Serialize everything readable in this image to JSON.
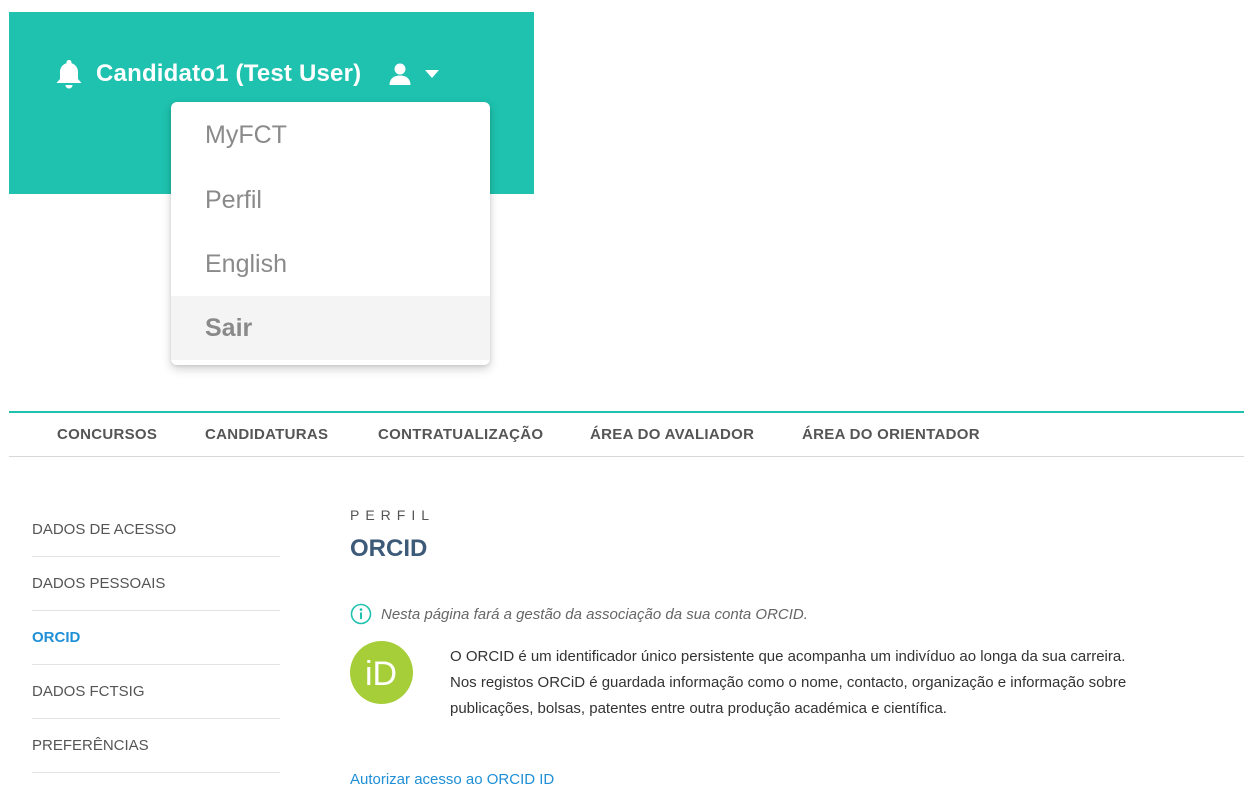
{
  "header": {
    "user_name": "Candidato1 (Test User)",
    "brand_color": "#1ec2ae"
  },
  "dropdown": {
    "items": [
      {
        "label": "MyFCT"
      },
      {
        "label": "Perfil"
      },
      {
        "label": "English"
      },
      {
        "label": "Sair"
      }
    ]
  },
  "nav": {
    "items": [
      {
        "label": "CONCURSOS"
      },
      {
        "label": "CANDIDATURAS"
      },
      {
        "label": "CONTRATUALIZAÇÃO"
      },
      {
        "label": "ÁREA DO AVALIADOR"
      },
      {
        "label": "ÁREA DO ORIENTADOR"
      }
    ]
  },
  "sidebar": {
    "items": [
      {
        "label": "DADOS DE ACESSO"
      },
      {
        "label": "DADOS PESSOAIS"
      },
      {
        "label": "ORCID"
      },
      {
        "label": "DADOS FCTSIG"
      },
      {
        "label": "PREFERÊNCIAS"
      }
    ],
    "active_color": "#1f8fd6"
  },
  "main": {
    "eyebrow": "PERFIL",
    "title": "ORCID",
    "info": "Nesta página fará a gestão da associação da sua conta ORCID.",
    "logo_text": "iD",
    "description": "O ORCID é um identificador único persistente que acompanha um indivíduo ao longa da sua carreira. Nos registos ORCiD é guardada informação como o nome, contacto, organização e informação sobre publicações, bolsas, patentes entre outra produção académica e científica.",
    "auth_link": "Autorizar acesso ao ORCID ID",
    "logo_color": "#a6ce39"
  }
}
